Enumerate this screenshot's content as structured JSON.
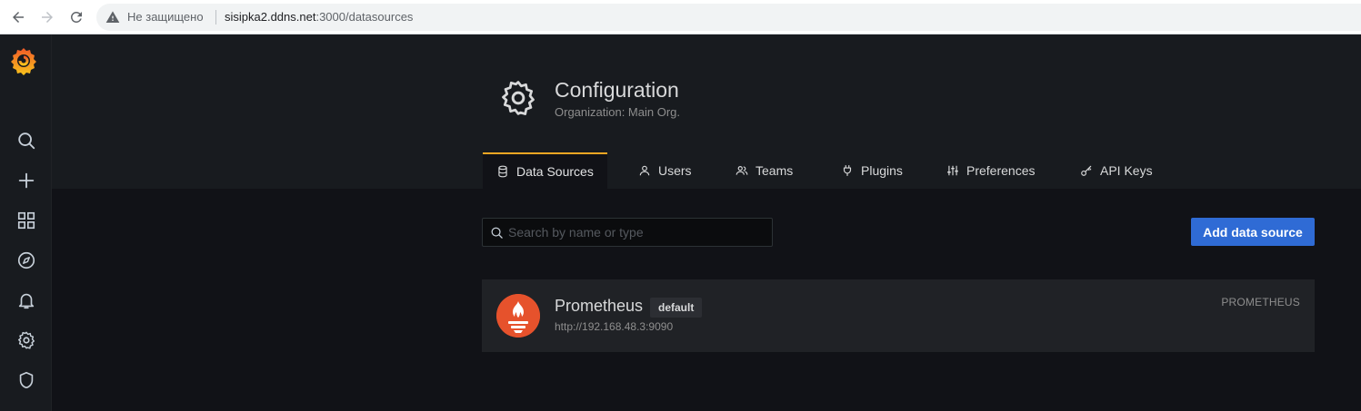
{
  "browser": {
    "insecure_label": "Не защищено",
    "url_host": "sisipka2.ddns.net",
    "url_path": ":3000/datasources"
  },
  "sidebar": {
    "items": [
      {
        "icon": "search-icon"
      },
      {
        "icon": "plus-icon"
      },
      {
        "icon": "dashboards-icon"
      },
      {
        "icon": "explore-icon"
      },
      {
        "icon": "bell-icon"
      },
      {
        "icon": "gear-icon"
      },
      {
        "icon": "shield-icon"
      }
    ]
  },
  "header": {
    "title": "Configuration",
    "subtitle": "Organization: Main Org."
  },
  "tabs": [
    {
      "label": "Data Sources",
      "icon": "database-icon",
      "active": true
    },
    {
      "label": "Users",
      "icon": "user-icon"
    },
    {
      "label": "Teams",
      "icon": "users-icon"
    },
    {
      "label": "Plugins",
      "icon": "plug-icon"
    },
    {
      "label": "Preferences",
      "icon": "sliders-icon"
    },
    {
      "label": "API Keys",
      "icon": "key-icon"
    }
  ],
  "search": {
    "placeholder": "Search by name or type"
  },
  "add_button_label": "Add data source",
  "datasources": [
    {
      "name": "Prometheus",
      "badge": "default",
      "url": "http://192.168.48.3:9090",
      "type": "PROMETHEUS"
    }
  ],
  "colors": {
    "accent": "#f5a623",
    "primary_button": "#2f6bd5",
    "prometheus": "#e6522c"
  }
}
